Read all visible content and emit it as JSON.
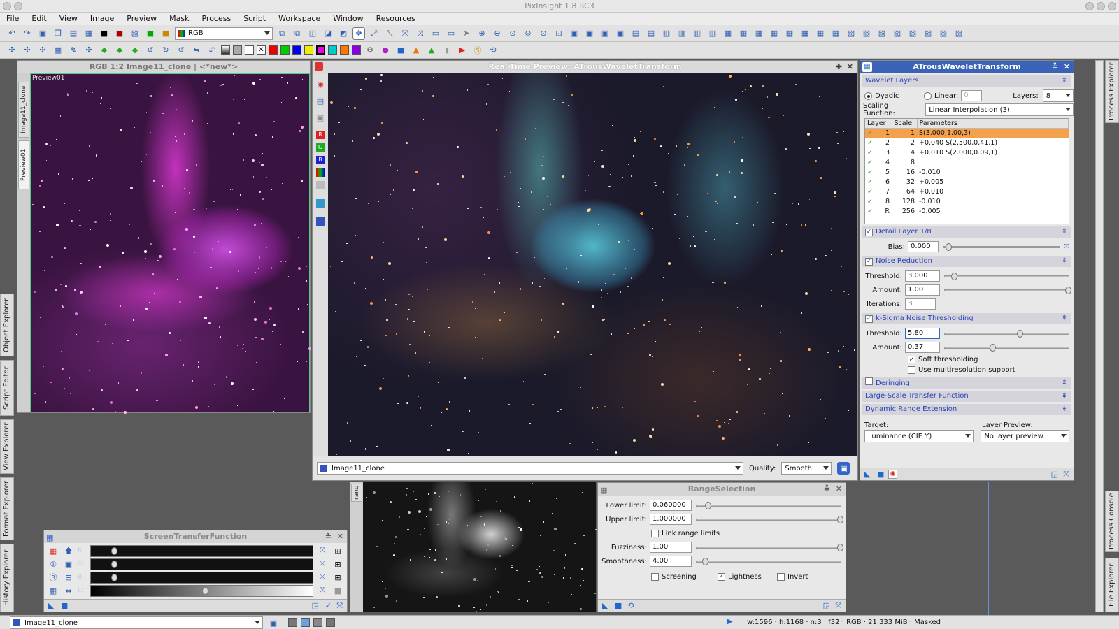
{
  "window": {
    "title": "PixInsight 1.8 RC3"
  },
  "menu": [
    "File",
    "Edit",
    "View",
    "Image",
    "Preview",
    "Mask",
    "Process",
    "Script",
    "Workspace",
    "Window",
    "Resources"
  ],
  "toolbar": {
    "channel_combo": "RGB"
  },
  "image_window": {
    "title": "RGB 1:2 Image11_clone | <*new*>",
    "preview_label": "Preview01",
    "tab1": "Image11_clone",
    "tab2": "Preview01"
  },
  "rtp": {
    "title": "Real-Time Preview: ATrousWaveletTransform",
    "view": "Image11_clone",
    "quality_label": "Quality:",
    "quality": "Smooth",
    "side_r": "R",
    "side_g": "G",
    "side_b": "B"
  },
  "atwt": {
    "title": "ATrousWaveletTransform",
    "wavelet_layers": "Wavelet Layers",
    "dyadic": "Dyadic",
    "linear": "Linear:",
    "linear_val": "0",
    "layers_label": "Layers:",
    "layers_val": "8",
    "scaling_label": "Scaling Function:",
    "scaling_val": "Linear Interpolation (3)",
    "cols": [
      "Layer",
      "Scale",
      "Parameters"
    ],
    "rows": [
      {
        "layer": "1",
        "scale": "1",
        "params": "S(3.000,1.00,3)"
      },
      {
        "layer": "2",
        "scale": "2",
        "params": "+0.040 S(2.500,0.41,1)"
      },
      {
        "layer": "3",
        "scale": "4",
        "params": "+0.010 S(2.000,0.09,1)"
      },
      {
        "layer": "4",
        "scale": "8",
        "params": ""
      },
      {
        "layer": "5",
        "scale": "16",
        "params": "-0.010"
      },
      {
        "layer": "6",
        "scale": "32",
        "params": "+0.005"
      },
      {
        "layer": "7",
        "scale": "64",
        "params": "+0.010"
      },
      {
        "layer": "8",
        "scale": "128",
        "params": "-0.010"
      },
      {
        "layer": "R",
        "scale": "256",
        "params": "-0.005"
      }
    ],
    "detail_layer": "Detail Layer 1/8",
    "bias_label": "Bias:",
    "bias": "0.000",
    "noise_reduction": "Noise Reduction",
    "nr_threshold_label": "Threshold:",
    "nr_threshold": "3.000",
    "nr_amount_label": "Amount:",
    "nr_amount": "1.00",
    "nr_iter_label": "Iterations:",
    "nr_iter": "3",
    "ksigma": "k-Sigma Noise Thresholding",
    "ks_threshold_label": "Threshold:",
    "ks_threshold": "5.80",
    "ks_amount_label": "Amount:",
    "ks_amount": "0.37",
    "soft": "Soft thresholding",
    "multires": "Use multiresolution support",
    "deringing": "Deringing",
    "lstf": "Large-Scale Transfer Function",
    "dre": "Dynamic Range Extension",
    "target_label": "Target:",
    "target": "Luminance (CIE Y)",
    "layer_preview_label": "Layer Preview:",
    "layer_preview": "No layer preview"
  },
  "range": {
    "title": "RangeSelection",
    "lower_label": "Lower limit:",
    "lower": "0.060000",
    "upper_label": "Upper limit:",
    "upper": "1.000000",
    "link": "Link range limits",
    "fuzz_label": "Fuzziness:",
    "fuzz": "1.00",
    "smooth_label": "Smoothness:",
    "smooth": "4.00",
    "screening": "Screening",
    "lightness": "Lightness",
    "invert": "Invert",
    "side": "rang"
  },
  "stf": {
    "title": "ScreenTransferFunction",
    "r": "R:",
    "g": "G:",
    "b": "B:",
    "l": "L:"
  },
  "side_tabs": {
    "process_explorer": "Process Explorer",
    "object_explorer": "Object Explorer",
    "script_editor": "Script Editor",
    "view_explorer": "View Explorer",
    "format_explorer": "Format Explorer",
    "history_explorer": "History Explorer",
    "process_console": "Process Console",
    "file_explorer": "File Explorer"
  },
  "status": {
    "view": "Image11_clone",
    "info": "w:1596 · h:1168 · n:3 · f32 · RGB · 21.333 MiB · Masked"
  }
}
